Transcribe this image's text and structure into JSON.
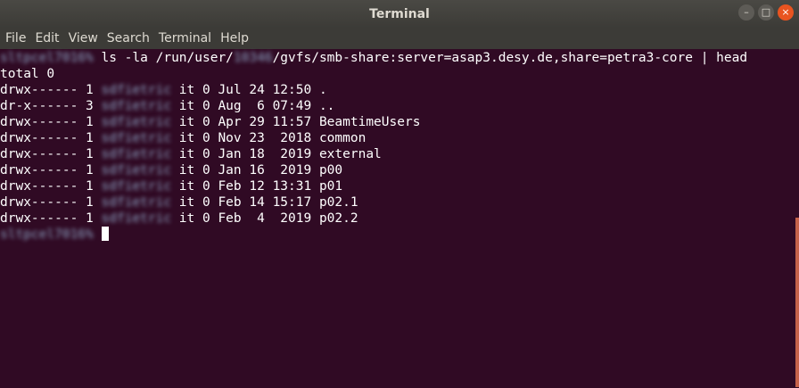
{
  "window": {
    "title": "Terminal",
    "controls": {
      "minimize": "–",
      "maximize": "□",
      "close": "×"
    }
  },
  "menu": [
    "File",
    "Edit",
    "View",
    "Search",
    "Terminal",
    "Help"
  ],
  "prompt": {
    "host": "sltpcel7016%",
    "uid": "10346",
    "cmd_part1": " ls -la /run/user/",
    "cmd_part2": "/gvfs/smb-share:server=asap3.desy.de,share=petra3-core | head"
  },
  "total": "total 0",
  "rows": [
    {
      "perm": "drwx------ 1 ",
      "owner": "sdfietric",
      "rest": " it 0 Jul 24 12:50 ."
    },
    {
      "perm": "dr-x------ 3 ",
      "owner": "sdfietric",
      "rest": " it 0 Aug  6 07:49 .."
    },
    {
      "perm": "drwx------ 1 ",
      "owner": "sdfietric",
      "rest": " it 0 Apr 29 11:57 BeamtimeUsers"
    },
    {
      "perm": "drwx------ 1 ",
      "owner": "sdfietric",
      "rest": " it 0 Nov 23  2018 common"
    },
    {
      "perm": "drwx------ 1 ",
      "owner": "sdfietric",
      "rest": " it 0 Jan 18  2019 external"
    },
    {
      "perm": "drwx------ 1 ",
      "owner": "sdfietric",
      "rest": " it 0 Jan 16  2019 p00"
    },
    {
      "perm": "drwx------ 1 ",
      "owner": "sdfietric",
      "rest": " it 0 Feb 12 13:31 p01"
    },
    {
      "perm": "drwx------ 1 ",
      "owner": "sdfietric",
      "rest": " it 0 Feb 14 15:17 p02.1"
    },
    {
      "perm": "drwx------ 1 ",
      "owner": "sdfietric",
      "rest": " it 0 Feb  4  2019 p02.2"
    }
  ],
  "colors": {
    "background": "#300a24",
    "titlebar": "#3c3b37",
    "close_button": "#e95420",
    "scrollbar": "#c6624a"
  }
}
